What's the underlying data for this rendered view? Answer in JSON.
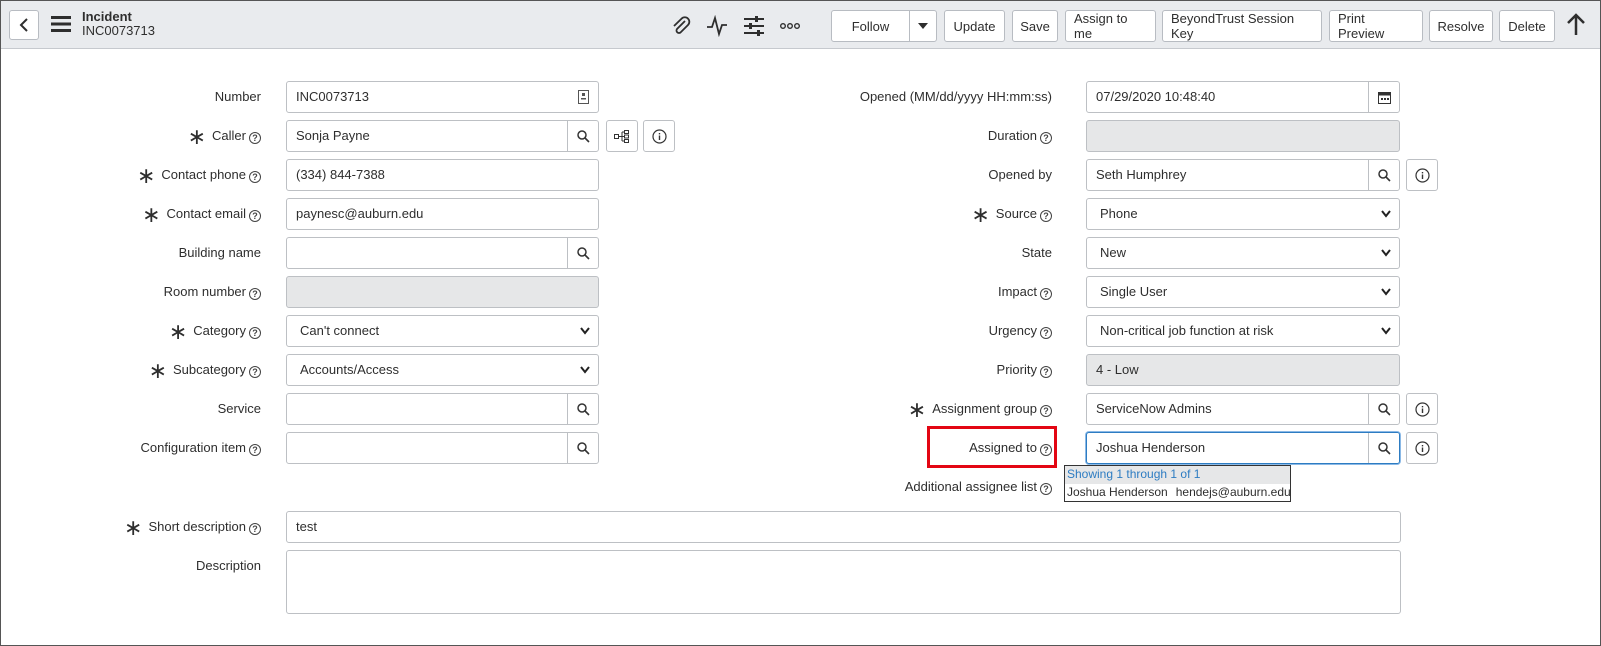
{
  "header": {
    "title": "Incident",
    "subtitle": "INC0073713",
    "icons": [
      "back-icon",
      "menu-icon",
      "attachment-icon",
      "activity-icon",
      "settings-sliders-icon",
      "more-options-icon",
      "scroll-up-icon"
    ],
    "buttons": {
      "follow": "Follow",
      "update": "Update",
      "save": "Save",
      "assign_to_me": "Assign to me",
      "beyondtrust": "BeyondTrust Session Key",
      "print_preview": "Print Preview",
      "resolve": "Resolve",
      "delete": "Delete"
    }
  },
  "left": {
    "number": {
      "label": "Number",
      "value": "INC0073713"
    },
    "caller": {
      "label": "Caller",
      "value": "Sonja Payne"
    },
    "contact_phone": {
      "label": "Contact phone",
      "value": "(334) 844-7388"
    },
    "contact_email": {
      "label": "Contact email",
      "value": "paynesc@auburn.edu"
    },
    "building_name": {
      "label": "Building name",
      "value": ""
    },
    "room_number": {
      "label": "Room number",
      "value": ""
    },
    "category": {
      "label": "Category",
      "value": "Can't connect"
    },
    "subcategory": {
      "label": "Subcategory",
      "value": "Accounts/Access"
    },
    "service": {
      "label": "Service",
      "value": ""
    },
    "configuration_item": {
      "label": "Configuration item",
      "value": ""
    }
  },
  "right": {
    "opened": {
      "label": "Opened (MM/dd/yyyy HH:mm:ss)",
      "value": "07/29/2020 10:48:40"
    },
    "duration": {
      "label": "Duration",
      "value": ""
    },
    "opened_by": {
      "label": "Opened by",
      "value": "Seth Humphrey"
    },
    "source": {
      "label": "Source",
      "value": "Phone"
    },
    "state": {
      "label": "State",
      "value": "New"
    },
    "impact": {
      "label": "Impact",
      "value": "Single User"
    },
    "urgency": {
      "label": "Urgency",
      "value": "Non-critical job function at risk"
    },
    "priority": {
      "label": "Priority",
      "value": "4 - Low"
    },
    "assignment_group": {
      "label": "Assignment group",
      "value": "ServiceNow Admins"
    },
    "assigned_to": {
      "label": "Assigned to",
      "value": "Joshua Henderson"
    },
    "additional_assignee": {
      "label": "Additional assignee list"
    }
  },
  "autocomplete": {
    "header": "Showing 1 through 1 of 1",
    "rows": [
      {
        "name": "Joshua Henderson",
        "email": "hendejs@auburn.edu"
      }
    ]
  },
  "bottom": {
    "short_description": {
      "label": "Short description",
      "value": "test"
    },
    "description": {
      "label": "Description",
      "value": ""
    }
  },
  "colors": {
    "accent": "#2d7cc2",
    "highlight": "#e30613",
    "header_bg": "#e9ebee",
    "readonly_bg": "#e6e7e8"
  }
}
